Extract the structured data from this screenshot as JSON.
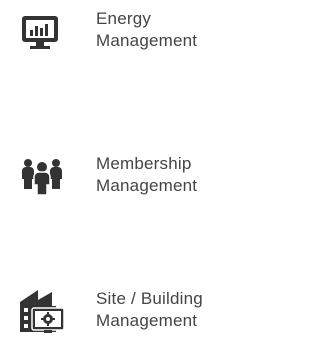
{
  "menu": {
    "items": [
      {
        "line1": "Energy",
        "line2": "Management",
        "icon": "monitor-chart-icon"
      },
      {
        "line1": "Membership",
        "line2": "Management",
        "icon": "people-group-icon"
      },
      {
        "line1": "Site / Building",
        "line2": "Management",
        "icon": "building-gear-icon"
      }
    ]
  },
  "colors": {
    "icon": "#333333",
    "text": "#444444",
    "background": "#ffffff"
  }
}
